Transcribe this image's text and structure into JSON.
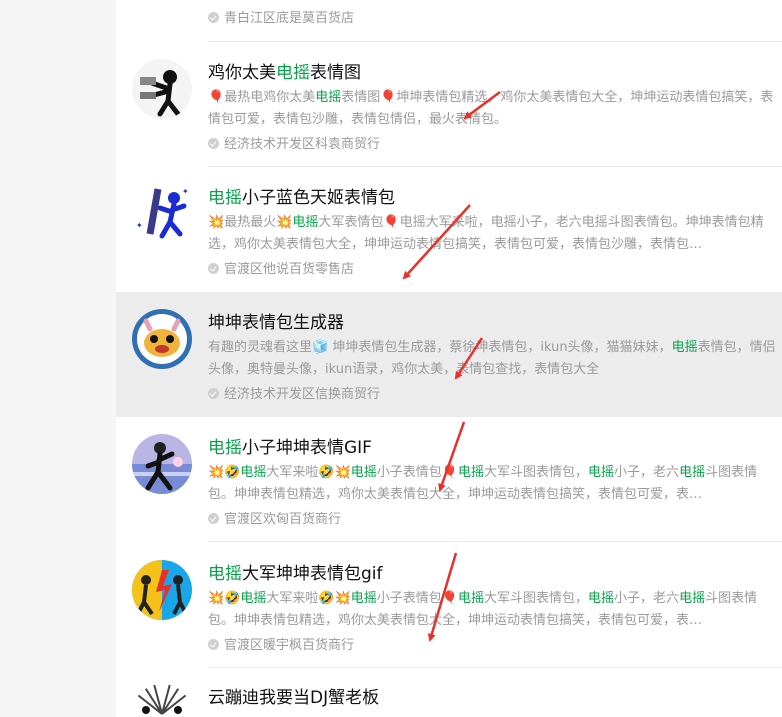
{
  "results": [
    {
      "store": "青白江区底是莫百货店"
    },
    {
      "title_parts": [
        "鸡你太美",
        "电摇",
        "表情图"
      ],
      "desc_parts": [
        {
          "t": "🎈"
        },
        {
          "t": "最热电鸡你太美"
        },
        {
          "t": "电摇",
          "hl": true
        },
        {
          "t": "表情图"
        },
        {
          "t": "🎈"
        },
        {
          "t": "坤坤表情包精选，鸡你太美表情包大全，坤坤运动表情包搞笑，表情包可爱，表情包沙雕，表情包情侣，最火表情包。"
        }
      ],
      "store": "经济技术开发区科袁商贸行"
    },
    {
      "title_parts": [
        "电摇",
        "小子蓝色天姬表情包"
      ],
      "desc_parts": [
        {
          "t": "💥"
        },
        {
          "t": "最热最火"
        },
        {
          "t": "💥"
        },
        {
          "t": "电摇",
          "hl": true
        },
        {
          "t": "大军表情包"
        },
        {
          "t": "🎈"
        },
        {
          "t": "电摇大军来啦，电摇小子，老六电摇斗图表情包。坤坤表情包精选，鸡你太美表情包大全，坤坤运动表情包搞笑，表情包可爱，表情包沙雕，表情包…"
        }
      ],
      "store": "官渡区他说百货零售店"
    },
    {
      "title": "坤坤表情包生成器",
      "desc_parts": [
        {
          "t": "有趣的灵魂看这里"
        },
        {
          "t": "🧊"
        },
        {
          "t": " 坤坤表情包生成器，蔡徐坤表情包，ikun头像，猫猫妹妹，"
        },
        {
          "t": "电摇",
          "hl": true
        },
        {
          "t": "表情包，情侣头像，奥特曼头像，ikun语录，鸡你太美，表情包查找，表情包大全"
        }
      ],
      "store": "经济技术开发区信换商贸行"
    },
    {
      "title_parts": [
        "电摇",
        "小子坤坤表情GIF"
      ],
      "desc_parts": [
        {
          "t": "💥🤣"
        },
        {
          "t": "电摇",
          "hl": true
        },
        {
          "t": "大军来啦"
        },
        {
          "t": "🤣💥"
        },
        {
          "t": "电摇",
          "hl": true
        },
        {
          "t": "小子表情包"
        },
        {
          "t": "🎈"
        },
        {
          "t": "电摇",
          "hl": true
        },
        {
          "t": "大军斗图表情包，"
        },
        {
          "t": "电摇",
          "hl": true
        },
        {
          "t": "小子，老六"
        },
        {
          "t": "电摇",
          "hl": true
        },
        {
          "t": "斗图表情包。坤坤表情包精选，鸡你太美表情包大全，坤坤运动表情包搞笑，表情包可爱，表…"
        }
      ],
      "store": "官渡区欢匈百货商行"
    },
    {
      "title_parts": [
        "电摇",
        "大军坤坤表情包gif"
      ],
      "desc_parts": [
        {
          "t": "💥🤣"
        },
        {
          "t": "电摇",
          "hl": true
        },
        {
          "t": "大军来啦"
        },
        {
          "t": "🤣💥"
        },
        {
          "t": "电摇",
          "hl": true
        },
        {
          "t": "小子表情包"
        },
        {
          "t": "🎈"
        },
        {
          "t": "电摇",
          "hl": true
        },
        {
          "t": "大军斗图表情包，"
        },
        {
          "t": "电摇",
          "hl": true
        },
        {
          "t": "小子，老六"
        },
        {
          "t": "电摇",
          "hl": true
        },
        {
          "t": "斗图表情包。坤坤表情包精选，鸡你太美表情包大全，坤坤运动表情包搞笑，表情包可爱，表…"
        }
      ],
      "store": "官渡区暖宇枫百货商行"
    },
    {
      "title": "云蹦迪我要当DJ蟹老板"
    }
  ],
  "colors": {
    "highlight": "#07a14a",
    "annotation_arrow": "#e8312a"
  }
}
